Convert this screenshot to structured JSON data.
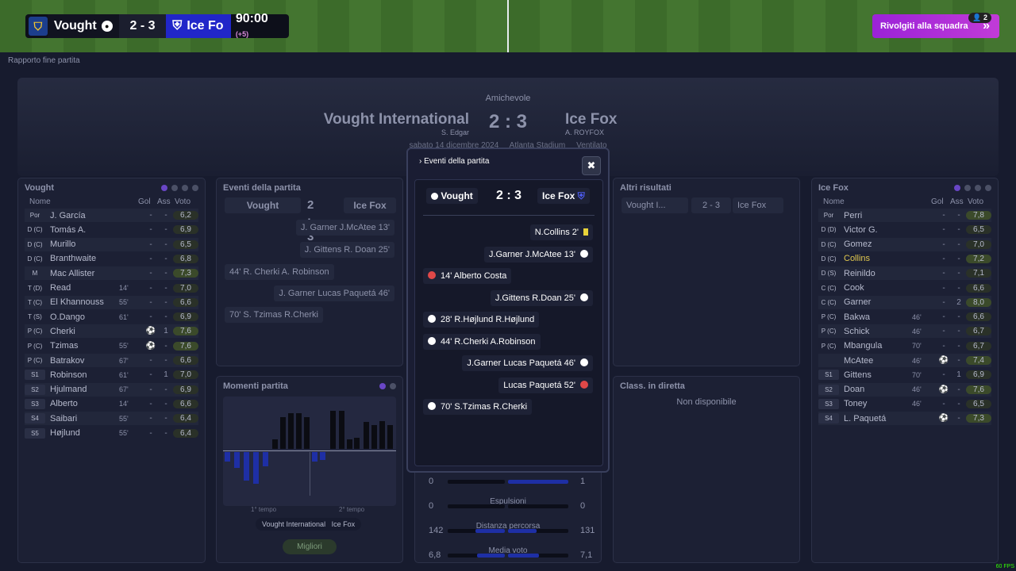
{
  "scoreboard": {
    "home_short": "Vought",
    "score": "2 - 3",
    "away_short": "Ice Fo",
    "time": "90:00",
    "extra": "(+5)"
  },
  "talk_button": {
    "label": "Rivolgiti alla squadra",
    "badge": "2"
  },
  "breadcrumb": "Rapporto fine partita",
  "header": {
    "competition": "Amichevole",
    "home": "Vought International",
    "home_coach": "S. Edgar",
    "score": "2 : 3",
    "away": "Ice Fox",
    "away_coach": "A. ROYFOX",
    "date": "sabato 14 dicembre 2024",
    "stadium": "Atlanta Stadium",
    "weather": "Ventilato"
  },
  "home_panel": {
    "title": "Vought",
    "col_name": "Nome",
    "col_gol": "Gol",
    "col_ass": "Ass",
    "col_voto": "Voto",
    "players": [
      {
        "pos": "Por",
        "name": "J. García",
        "sub": "",
        "g": "-",
        "a": "-",
        "v": "6,2"
      },
      {
        "pos": "D (C)",
        "name": "Tomás A.",
        "sub": "",
        "g": "-",
        "a": "-",
        "v": "6,9"
      },
      {
        "pos": "D (C)",
        "name": "Murillo",
        "sub": "",
        "g": "-",
        "a": "-",
        "v": "6,5"
      },
      {
        "pos": "D (C)",
        "name": "Branthwaite",
        "sub": "",
        "g": "-",
        "a": "-",
        "v": "6,8"
      },
      {
        "pos": "M",
        "name": "Mac Allister",
        "sub": "",
        "g": "-",
        "a": "-",
        "v": "7,3"
      },
      {
        "pos": "T (D)",
        "name": "Read",
        "sub": "14'",
        "g": "-",
        "a": "-",
        "v": "7,0"
      },
      {
        "pos": "T (C)",
        "name": "El Khannouss",
        "sub": "55'",
        "g": "-",
        "a": "-",
        "v": "6,6"
      },
      {
        "pos": "T (S)",
        "name": "O.Dango",
        "sub": "61'",
        "g": "-",
        "a": "-",
        "v": "6,9"
      },
      {
        "pos": "P (C)",
        "name": "Cherki",
        "sub": "",
        "g": "⚽",
        "a": "1",
        "v": "7,6"
      },
      {
        "pos": "P (C)",
        "name": "Tzimas",
        "sub": "55'",
        "g": "⚽",
        "a": "-",
        "v": "7,6"
      },
      {
        "pos": "P (C)",
        "name": "Batrakov",
        "sub": "67'",
        "g": "-",
        "a": "-",
        "v": "6,6"
      },
      {
        "pos": "S1",
        "name": "Robinson",
        "sub": "61'",
        "g": "-",
        "a": "1",
        "v": "7,0"
      },
      {
        "pos": "S2",
        "name": "Hjulmand",
        "sub": "67'",
        "g": "-",
        "a": "-",
        "v": "6,9"
      },
      {
        "pos": "S3",
        "name": "Alberto",
        "sub": "14'",
        "g": "-",
        "a": "-",
        "v": "6,6"
      },
      {
        "pos": "S4",
        "name": "Saibari",
        "sub": "55'",
        "g": "-",
        "a": "-",
        "v": "6,4"
      },
      {
        "pos": "S5",
        "name": "Højlund",
        "sub": "55'",
        "g": "-",
        "a": "-",
        "v": "6,4"
      }
    ]
  },
  "away_panel": {
    "title": "Ice Fox",
    "col_name": "Nome",
    "col_gol": "Gol",
    "col_ass": "Ass",
    "col_voto": "Voto",
    "players": [
      {
        "pos": "Por",
        "name": "Perri",
        "sub": "",
        "g": "-",
        "a": "-",
        "v": "7,8"
      },
      {
        "pos": "D (D)",
        "name": "Victor G.",
        "sub": "",
        "g": "-",
        "a": "-",
        "v": "6,5"
      },
      {
        "pos": "D (C)",
        "name": "Gomez",
        "sub": "",
        "g": "-",
        "a": "-",
        "v": "7,0"
      },
      {
        "pos": "D (C)",
        "name": "Collins",
        "sub": "",
        "g": "-",
        "a": "-",
        "v": "7,2"
      },
      {
        "pos": "D (S)",
        "name": "Reinildo",
        "sub": "",
        "g": "-",
        "a": "-",
        "v": "7,1"
      },
      {
        "pos": "C (C)",
        "name": "Cook",
        "sub": "",
        "g": "-",
        "a": "-",
        "v": "6,6"
      },
      {
        "pos": "C (C)",
        "name": "Garner",
        "sub": "",
        "g": "-",
        "a": "2",
        "v": "8,0"
      },
      {
        "pos": "P (C)",
        "name": "Bakwa",
        "sub": "46'",
        "g": "-",
        "a": "-",
        "v": "6,6"
      },
      {
        "pos": "P (C)",
        "name": "Schick",
        "sub": "46'",
        "g": "-",
        "a": "-",
        "v": "6,7"
      },
      {
        "pos": "P (C)",
        "name": "Mbangula",
        "sub": "70'",
        "g": "-",
        "a": "-",
        "v": "6,7"
      },
      {
        "pos": "",
        "name": "McAtee",
        "sub": "46'",
        "g": "⚽",
        "a": "-",
        "v": "7,4"
      },
      {
        "pos": "S1",
        "name": "Gittens",
        "sub": "70'",
        "g": "-",
        "a": "1",
        "v": "6,9"
      },
      {
        "pos": "S2",
        "name": "Doan",
        "sub": "46'",
        "g": "⚽",
        "a": "-",
        "v": "7,6"
      },
      {
        "pos": "S3",
        "name": "Toney",
        "sub": "46'",
        "g": "-",
        "a": "-",
        "v": "6,5"
      },
      {
        "pos": "S4",
        "name": "L. Paquetá",
        "sub": "",
        "g": "⚽",
        "a": "-",
        "v": "7,3"
      }
    ]
  },
  "events_panel": {
    "title": "Eventi della partita",
    "home": "Vought",
    "score": "2 : 3",
    "away": "Ice Fox",
    "rows": [
      "J. Garner  J.McAtee  13'",
      "J. Gittens  R. Doan  25'",
      "44'  R. Cherki  A. Robinson",
      "J. Garner  Lucas Paquetá  46'",
      "70'  S. Tzimas  R.Cherki"
    ]
  },
  "moments_panel": {
    "title": "Momenti partita",
    "half1": "1° tempo",
    "half2": "2° tempo",
    "legend_home": "Vought International",
    "legend_away": "Ice Fox",
    "best_button": "Migliori"
  },
  "results_panel": {
    "title": "Altri risultati",
    "home": "Vought I...",
    "score": "2 - 3",
    "away": "Ice Fox"
  },
  "live_panel": {
    "title": "Class. in diretta",
    "empty": "Non disponibile"
  },
  "stats": [
    {
      "label": "",
      "home": "0",
      "away": "1"
    },
    {
      "label": "Espulsioni",
      "home": "0",
      "away": "0"
    },
    {
      "label": "Distanza percorsa",
      "home": "142",
      "away": "131"
    },
    {
      "label": "Media voto",
      "home": "6,8",
      "away": "7,1"
    }
  ],
  "modal": {
    "title": "Eventi della partita",
    "close": "✖",
    "home": "Vought",
    "score": "2 : 3",
    "away": "Ice Fox",
    "events": [
      {
        "text": "N.Collins  2'",
        "side": "away",
        "icon": "yellow"
      },
      {
        "text": "J.Garner  J.McAtee  13'",
        "side": "away",
        "icon": "ball"
      },
      {
        "text": "14'  Alberto Costa",
        "side": "home",
        "icon": "red"
      },
      {
        "text": "J.Gittens  R.Doan  25'",
        "side": "away",
        "icon": "ball"
      },
      {
        "text": "28'  R.Højlund  R.Højlund",
        "side": "home",
        "icon": "sub"
      },
      {
        "text": "44'  R.Cherki  A.Robinson",
        "side": "home",
        "icon": "ball"
      },
      {
        "text": "J.Garner  Lucas Paquetá  46'",
        "side": "away",
        "icon": "ball"
      },
      {
        "text": "Lucas Paquetá  52'",
        "side": "away",
        "icon": "red"
      },
      {
        "text": "70'  S.Tzimas  R.Cherki",
        "side": "home",
        "icon": "ball"
      }
    ]
  },
  "fps": "60 FPS"
}
